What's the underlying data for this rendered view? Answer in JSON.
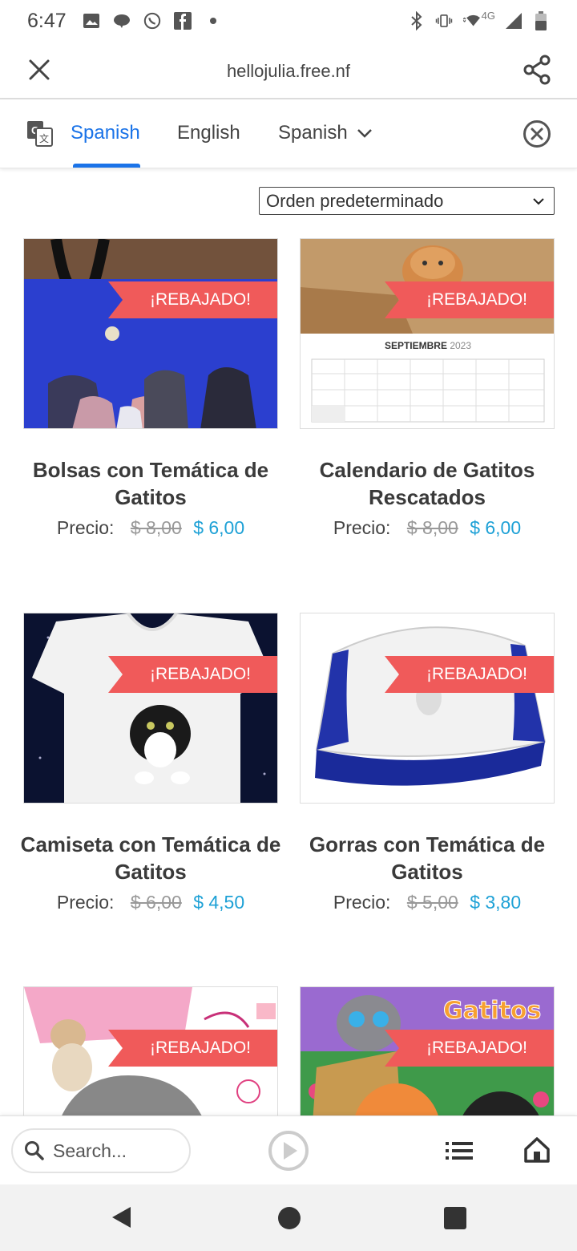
{
  "status_bar": {
    "time": "6:47",
    "network": "4G",
    "icons_left": [
      "image-icon",
      "chat-bubble-icon",
      "whatsapp-icon",
      "facebook-icon",
      "dot-icon"
    ],
    "icons_right": [
      "bluetooth-icon",
      "vibrate-icon",
      "wifi-icon",
      "signal-icon",
      "battery-icon"
    ]
  },
  "browser": {
    "url": "hellojulia.free.nf"
  },
  "translate_bar": {
    "tabs": [
      "Spanish",
      "English"
    ],
    "dropdown_label": "Spanish",
    "active_tab": "Spanish"
  },
  "sort": {
    "selected": "Orden predeterminado"
  },
  "products": [
    {
      "title": "Bolsas con Temática de Gatitos",
      "badge": "¡REBAJADO!",
      "price_label": "Precio:",
      "old_price": "$ 8,00",
      "new_price": "$ 6,00"
    },
    {
      "title": "Calendario de Gatitos Rescatados",
      "badge": "¡REBAJADO!",
      "price_label": "Precio:",
      "old_price": "$ 8,00",
      "new_price": "$ 6,00",
      "calendar_month": "SEPTIEMBRE",
      "calendar_year": "2023"
    },
    {
      "title": "Camiseta con Temática de Gatitos",
      "badge": "¡REBAJADO!",
      "price_label": "Precio:",
      "old_price": "$ 6,00",
      "new_price": "$ 4,50"
    },
    {
      "title": "Gorras con Temática de Gatitos",
      "badge": "¡REBAJADO!",
      "price_label": "Precio:",
      "old_price": "$ 5,00",
      "new_price": "$ 3,80"
    },
    {
      "title": "",
      "badge": "¡REBAJADO!"
    },
    {
      "title": "",
      "badge": "¡REBAJADO!",
      "image_text": "Gatitos"
    }
  ],
  "bottom_bar": {
    "search_placeholder": "Search..."
  },
  "colors": {
    "accent_blue": "#1a73e8",
    "sale_red": "#f05a5a",
    "price_blue": "#1ea1d6"
  }
}
